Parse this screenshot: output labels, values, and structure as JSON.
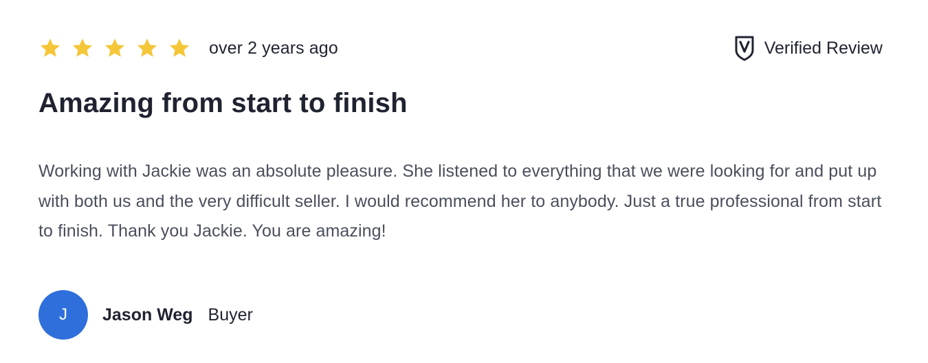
{
  "review": {
    "rating": 5,
    "rating_max": 5,
    "time_ago": "over 2 years ago",
    "verified_label": "Verified Review",
    "title": "Amazing from start to finish",
    "body": "Working with Jackie was an absolute pleasure. She listened to everything that we were looking for and put up with both us and the very difficult seller. I would recommend her to anybody. Just a true professional from start to finish. Thank you Jackie. You are amazing!",
    "author": {
      "initial": "J",
      "name": "Jason Weg",
      "role": "Buyer"
    }
  },
  "icons": {
    "star": "star-icon",
    "verified": "shield-check-icon"
  },
  "colors": {
    "star": "#f5c638",
    "avatar": "#2f6fdb",
    "text_primary": "#1f2330",
    "text_body": "#4a4f5c"
  }
}
